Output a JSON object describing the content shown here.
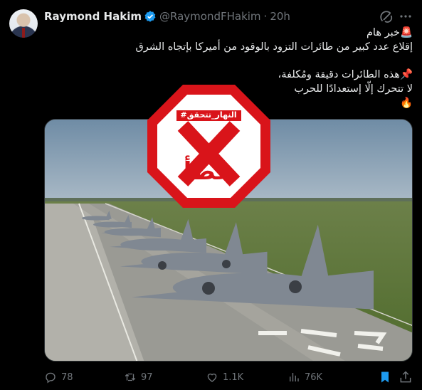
{
  "author": {
    "name": "Raymond Hakim",
    "handle": "@RaymondFHakim",
    "separator": "·",
    "time": "20h"
  },
  "tweet": {
    "line1": "🚨خبر هام",
    "line2": "إقلاع عدد كبير من طائرات التزود بالوقود من أميركا بإتجاه الشرق",
    "line3": "📌هذه الطائرات دقيقة ومُكلفة،",
    "line4": "لا تتحرك إلّا إستعدادًا للحرب",
    "line5": "🔥"
  },
  "stamp": {
    "tag": "#النهار_تتحقق",
    "mark": "X",
    "word": "خطأ"
  },
  "actions": {
    "replies": "78",
    "reposts": "97",
    "likes": "1.1K",
    "views": "76K"
  },
  "icons": {
    "verified": "verified-badge-icon",
    "grok": "grok-icon",
    "more": "more-dots-icon",
    "reply": "reply-icon",
    "repost": "repost-icon",
    "like": "heart-icon",
    "views": "views-chart-icon",
    "bookmark": "bookmark-icon",
    "share": "share-icon"
  },
  "colors": {
    "background": "#000000",
    "text": "#e7e9ea",
    "muted": "#71767b",
    "verified": "#1d9bf0",
    "bookmark_active": "#1d9bf0",
    "stamp_red": "#d9141a"
  }
}
